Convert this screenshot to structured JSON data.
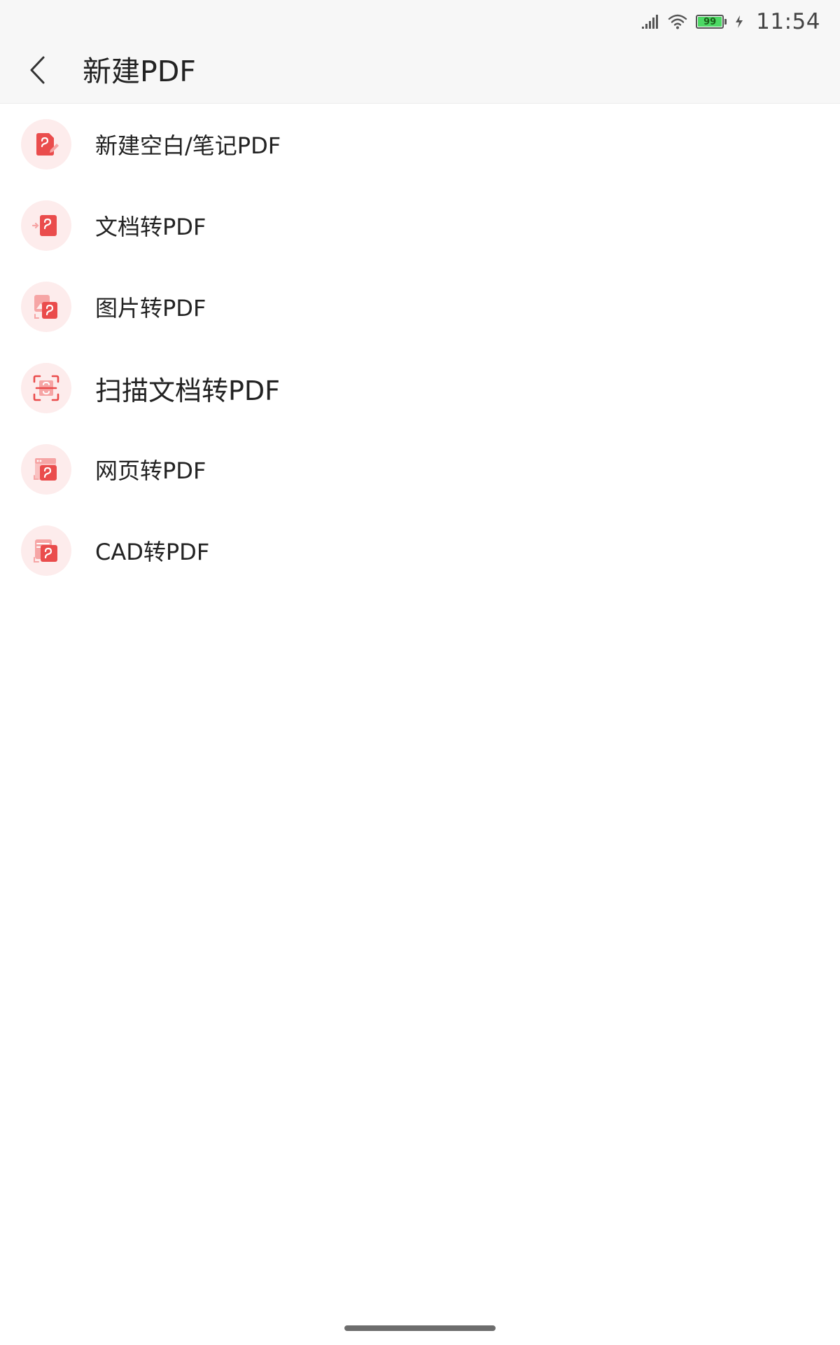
{
  "status_bar": {
    "time": "11:54",
    "battery_level": "99",
    "signal_icon": "signal-icon",
    "wifi_icon": "wifi-icon",
    "charging_icon": "charging-icon"
  },
  "app_bar": {
    "back_icon": "chevron-left-icon",
    "title": "新建PDF"
  },
  "menu": {
    "items": [
      {
        "label": "新建空白/笔记PDF",
        "icon": "pdf-note-icon"
      },
      {
        "label": "文档转PDF",
        "icon": "doc-to-pdf-icon"
      },
      {
        "label": "图片转PDF",
        "icon": "image-to-pdf-icon"
      },
      {
        "label": "扫描文档转PDF",
        "icon": "scan-to-pdf-icon"
      },
      {
        "label": "网页转PDF",
        "icon": "web-to-pdf-icon"
      },
      {
        "label": "CAD转PDF",
        "icon": "cad-to-pdf-icon"
      }
    ]
  },
  "colors": {
    "accent": "#ea4c4c",
    "accent_light": "#fdecec",
    "header_bg": "#f7f7f7",
    "text": "#222222"
  }
}
